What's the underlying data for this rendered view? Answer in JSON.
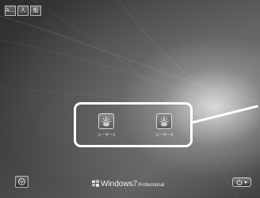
{
  "toolbar": {
    "ime_label": "A…",
    "accessibility_label": "人",
    "input_mode_label": "般"
  },
  "users": [
    {
      "name": "ユーザー1",
      "icon": "user-picture-icon"
    },
    {
      "name": "ユーザー2",
      "icon": "user-picture-icon"
    }
  ],
  "brand": {
    "windows": "Windows",
    "version": "7",
    "edition": "Professional"
  },
  "bottom": {
    "ease_of_access_icon": "ease-of-access-icon",
    "power_icon": "power-icon"
  }
}
